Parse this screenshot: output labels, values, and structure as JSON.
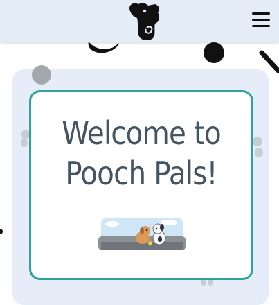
{
  "header": {
    "logo_icon": "dog-head-logo-icon",
    "menu_icon": "hamburger-menu-icon"
  },
  "hero": {
    "title": "Welcome to Pooch Pals!",
    "image_icon": "dogs-playing-illustration"
  },
  "colors": {
    "header_bg": "#e4ecf7",
    "panel_bg": "#e6edf8",
    "card_border": "#2ea39a",
    "title_text": "#435563"
  }
}
